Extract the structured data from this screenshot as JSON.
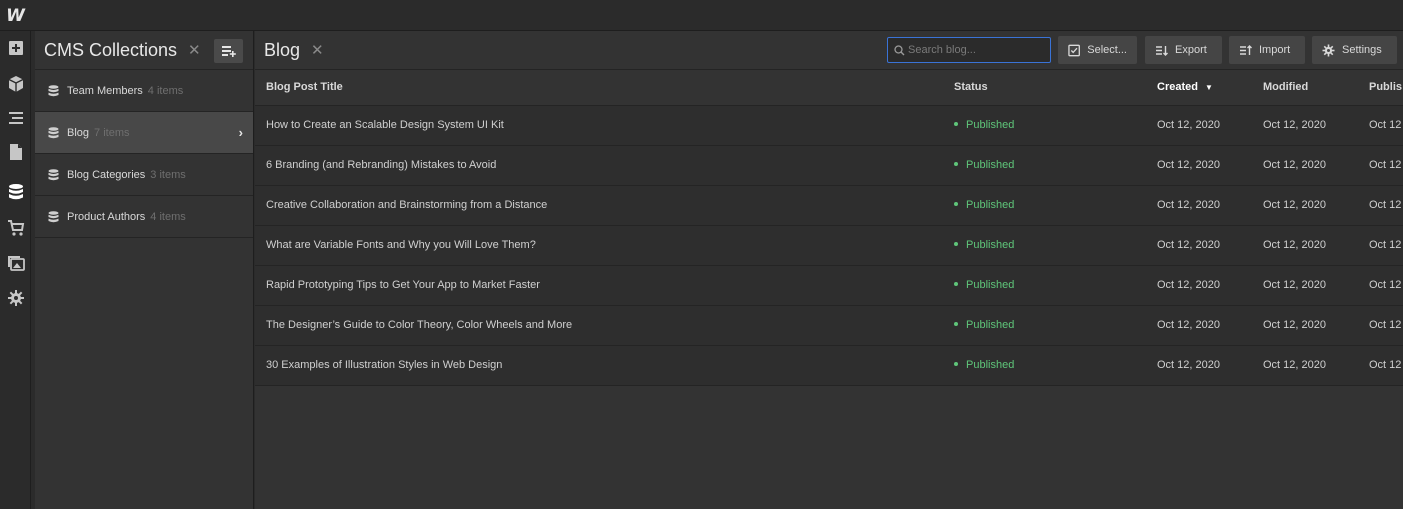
{
  "app": {
    "logo": "W"
  },
  "rail": {
    "items": [
      {
        "name": "add-icon"
      },
      {
        "name": "box-icon"
      },
      {
        "name": "navigator-icon"
      },
      {
        "name": "pages-icon"
      },
      {
        "name": "cms-icon",
        "active": true
      },
      {
        "name": "ecommerce-icon"
      },
      {
        "name": "assets-icon"
      },
      {
        "name": "settings-icon"
      }
    ]
  },
  "collections": {
    "title": "CMS Collections",
    "close": "✕",
    "items": [
      {
        "name": "Team Members",
        "count": "4 items"
      },
      {
        "name": "Blog",
        "count": "7 items",
        "active": true,
        "chevron": "›"
      },
      {
        "name": "Blog Categories",
        "count": "3 items"
      },
      {
        "name": "Product Authors",
        "count": "4 items"
      }
    ]
  },
  "blog": {
    "title": "Blog",
    "close": "✕",
    "search": {
      "placeholder": "Search blog...",
      "value": ""
    },
    "toolbar": {
      "select_label": "Select...",
      "export_label": "Export",
      "import_label": "Import",
      "settings_label": "Settings"
    },
    "columns": [
      "Blog Post Title",
      "Status",
      "Created",
      "Modified",
      "Publis"
    ],
    "sort_caret": "▼",
    "status_color": "#5fc67a",
    "rows": [
      {
        "title": "How to Create an Scalable Design System UI Kit",
        "status": "Published",
        "created": "Oct 12, 2020",
        "modified": "Oct 12, 2020",
        "published": "Oct 12"
      },
      {
        "title": "6 Branding (and Rebranding) Mistakes to Avoid",
        "status": "Published",
        "created": "Oct 12, 2020",
        "modified": "Oct 12, 2020",
        "published": "Oct 12"
      },
      {
        "title": "Creative Collaboration and Brainstorming from a Distance",
        "status": "Published",
        "created": "Oct 12, 2020",
        "modified": "Oct 12, 2020",
        "published": "Oct 12"
      },
      {
        "title": "What are Variable Fonts and Why you Will Love Them?",
        "status": "Published",
        "created": "Oct 12, 2020",
        "modified": "Oct 12, 2020",
        "published": "Oct 12"
      },
      {
        "title": "Rapid Prototyping Tips to Get Your App to Market Faster",
        "status": "Published",
        "created": "Oct 12, 2020",
        "modified": "Oct 12, 2020",
        "published": "Oct 12"
      },
      {
        "title": "The Designer’s Guide to Color Theory, Color Wheels and More",
        "status": "Published",
        "created": "Oct 12, 2020",
        "modified": "Oct 12, 2020",
        "published": "Oct 12"
      },
      {
        "title": "30 Examples of Illustration Styles in Web Design",
        "status": "Published",
        "created": "Oct 12, 2020",
        "modified": "Oct 12, 2020",
        "published": "Oct 12"
      }
    ]
  }
}
